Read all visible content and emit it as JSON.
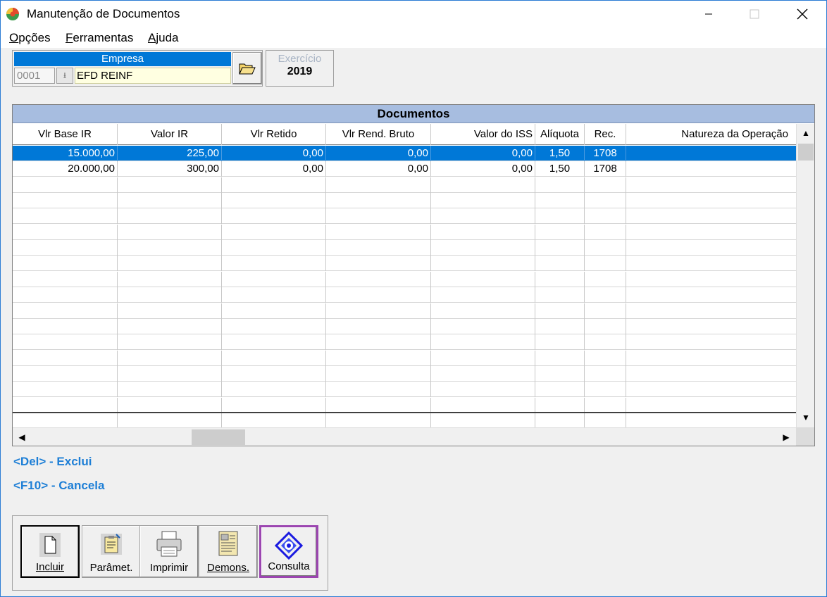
{
  "window": {
    "title": "Manutenção de Documentos"
  },
  "menu": {
    "items": [
      {
        "label": "Opções",
        "accel": "O",
        "rest": "pções"
      },
      {
        "label": "Ferramentas",
        "accel": "F",
        "rest": "erramentas"
      },
      {
        "label": "Ajuda",
        "accel": "A",
        "rest": "juda"
      }
    ]
  },
  "empresa": {
    "header": "Empresa",
    "code": "0001",
    "name": "EFD REINF"
  },
  "exercicio": {
    "label": "Exercício",
    "value": "2019"
  },
  "grid": {
    "title": "Documentos",
    "columns": [
      "Vlr Base IR",
      "Valor IR",
      "Vlr Retido",
      "Vlr Rend. Bruto",
      "Valor do ISS",
      "Alíquota",
      "Rec.",
      "Natureza da Operação"
    ],
    "rows": [
      [
        "15.000,00",
        "225,00",
        "0,00",
        "0,00",
        "0,00",
        "1,50",
        "1708",
        ""
      ],
      [
        "20.000,00",
        "300,00",
        "0,00",
        "0,00",
        "0,00",
        "1,50",
        "1708",
        ""
      ]
    ],
    "selected_row": 0
  },
  "hints": {
    "delete": "<Del> - Exclui",
    "cancel": "<F10> - Cancela"
  },
  "toolbar": {
    "incluir": "Incluir",
    "parametros": "Parâmet.",
    "imprimir": "Imprimir",
    "demons": "Demons.",
    "consulta": "Consulta"
  },
  "colors": {
    "selection": "#0078d7",
    "grid_title": "#a7bde0",
    "hint": "#1e7fd6",
    "focus": "#9b45b0"
  }
}
